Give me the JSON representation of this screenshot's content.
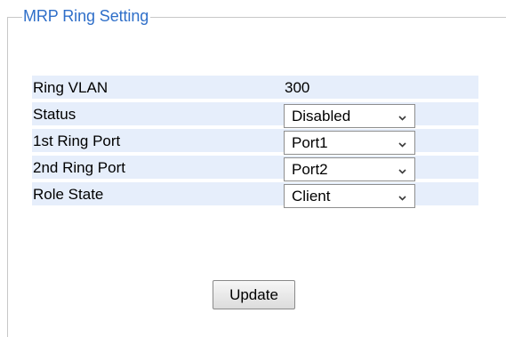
{
  "panel": {
    "title": "MRP Ring Setting"
  },
  "fields": {
    "ring_vlan": {
      "label": "Ring VLAN",
      "value": "300"
    },
    "status": {
      "label": "Status",
      "value": "Disabled"
    },
    "ring_port_1": {
      "label": "1st Ring Port",
      "value": "Port1"
    },
    "ring_port_2": {
      "label": "2nd Ring Port",
      "value": "Port2"
    },
    "role_state": {
      "label": "Role State",
      "value": "Client"
    }
  },
  "actions": {
    "update_label": "Update"
  },
  "icons": {
    "dropdown": "chevron-down-icon"
  },
  "colors": {
    "title": "#2f6fc9",
    "row_background": "#e6eefb",
    "border": "#c8c8c8"
  }
}
